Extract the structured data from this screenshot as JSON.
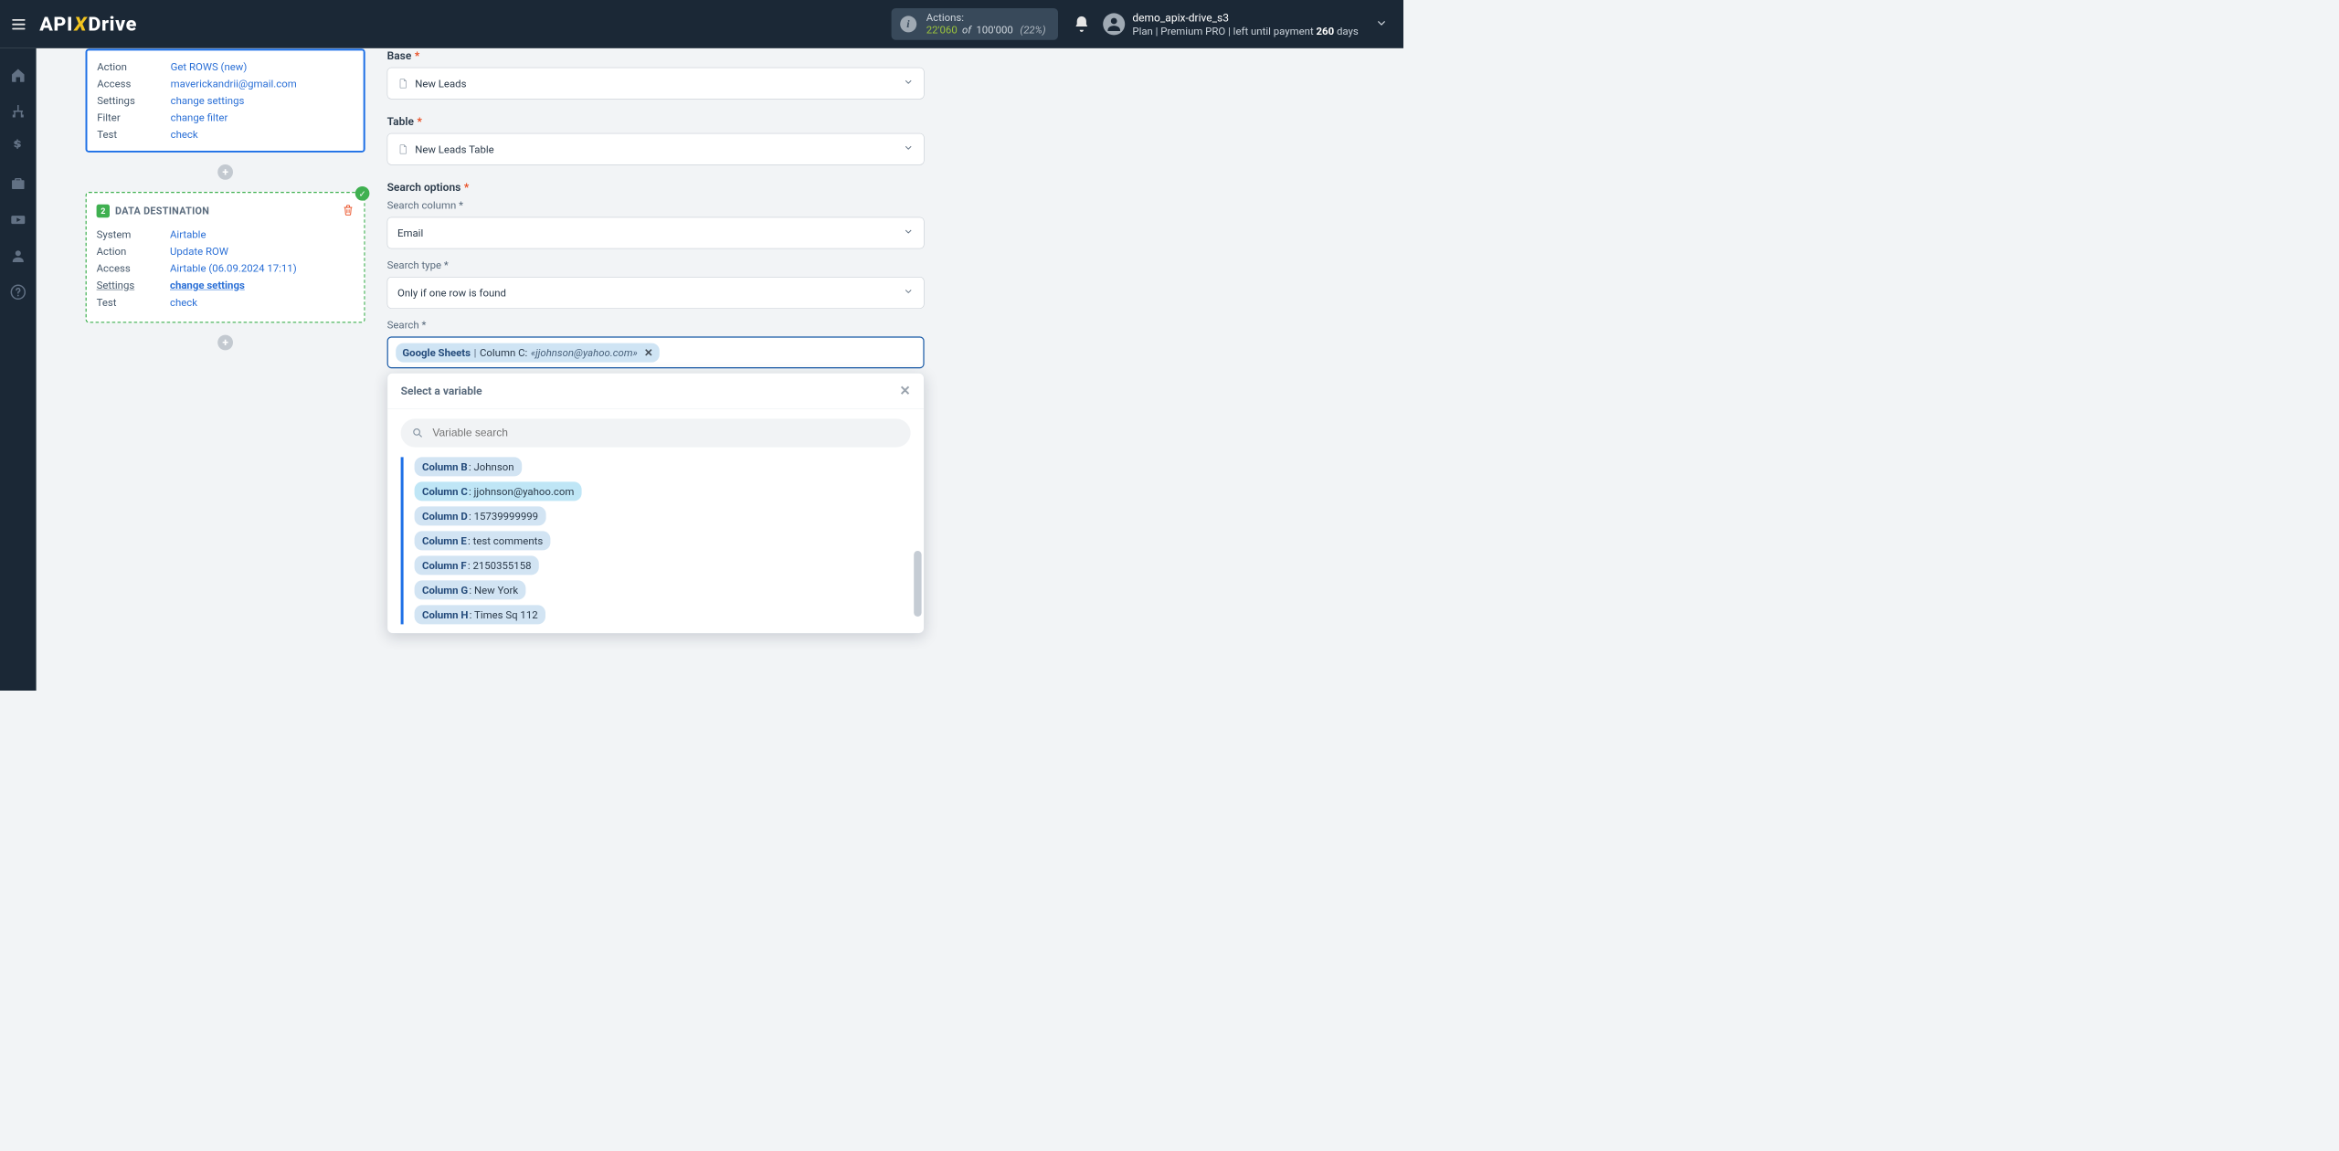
{
  "brand": {
    "api": "API",
    "x": "X",
    "drive": "Drive"
  },
  "header": {
    "actions_label": "Actions:",
    "used": "22'060",
    "of": "of",
    "total": "100'000",
    "pct": "(22%)",
    "user": "demo_apix-drive_s3",
    "plan_prefix": "Plan |",
    "plan_name": "Premium PRO",
    "plan_mid": "| left until payment ",
    "plan_days": "260",
    "plan_days_suffix": " days"
  },
  "rail": {
    "items": [
      {
        "name": "home-icon"
      },
      {
        "name": "sitemap-icon"
      },
      {
        "name": "dollar-icon"
      },
      {
        "name": "briefcase-icon"
      },
      {
        "name": "youtube-icon"
      },
      {
        "name": "user-icon"
      },
      {
        "name": "help-icon"
      }
    ]
  },
  "source_card": {
    "rows": {
      "action_k": "Action",
      "action_v": "Get ROWS (new)",
      "access_k": "Access",
      "access_v": "maverickandrii@gmail.com",
      "settings_k": "Settings",
      "settings_v": "change settings",
      "filter_k": "Filter",
      "filter_v": "change filter",
      "test_k": "Test",
      "test_v": "check"
    }
  },
  "dest_card": {
    "badge": "2",
    "title": "DATA DESTINATION",
    "rows": {
      "system_k": "System",
      "system_v": "Airtable",
      "action_k": "Action",
      "action_v": "Update ROW",
      "access_k": "Access",
      "access_v": "Airtable (06.09.2024 17:11)",
      "settings_k": "Settings",
      "settings_v": "change settings",
      "test_k": "Test",
      "test_v": "check"
    }
  },
  "form": {
    "base_label": "Base",
    "base_value": "New Leads",
    "table_label": "Table",
    "table_value": "New Leads Table",
    "search_options_label": "Search options",
    "search_column_label": "Search column *",
    "search_column_value": "Email",
    "search_type_label": "Search type *",
    "search_type_value": "Only if one row is found",
    "search_label": "Search *",
    "token": {
      "src": "Google Sheets",
      "sep": " | ",
      "col": "Column C: ",
      "val": "«jjohnson@yahoo.com»"
    },
    "dropdown": {
      "title": "Select a variable",
      "placeholder": "Variable search",
      "items": [
        {
          "col": "Column B",
          "val": ": Johnson"
        },
        {
          "col": "Column C",
          "val": ": jjohnson@yahoo.com",
          "selected": true
        },
        {
          "col": "Column D",
          "val": ": 15739999999"
        },
        {
          "col": "Column E",
          "val": ": test comments"
        },
        {
          "col": "Column F",
          "val": ": 2150355158"
        },
        {
          "col": "Column G",
          "val": ": New York"
        },
        {
          "col": "Column H",
          "val": ": Times Sq 112"
        }
      ]
    }
  },
  "icons": {
    "plus": "+",
    "check": "✓",
    "x": "✕"
  }
}
